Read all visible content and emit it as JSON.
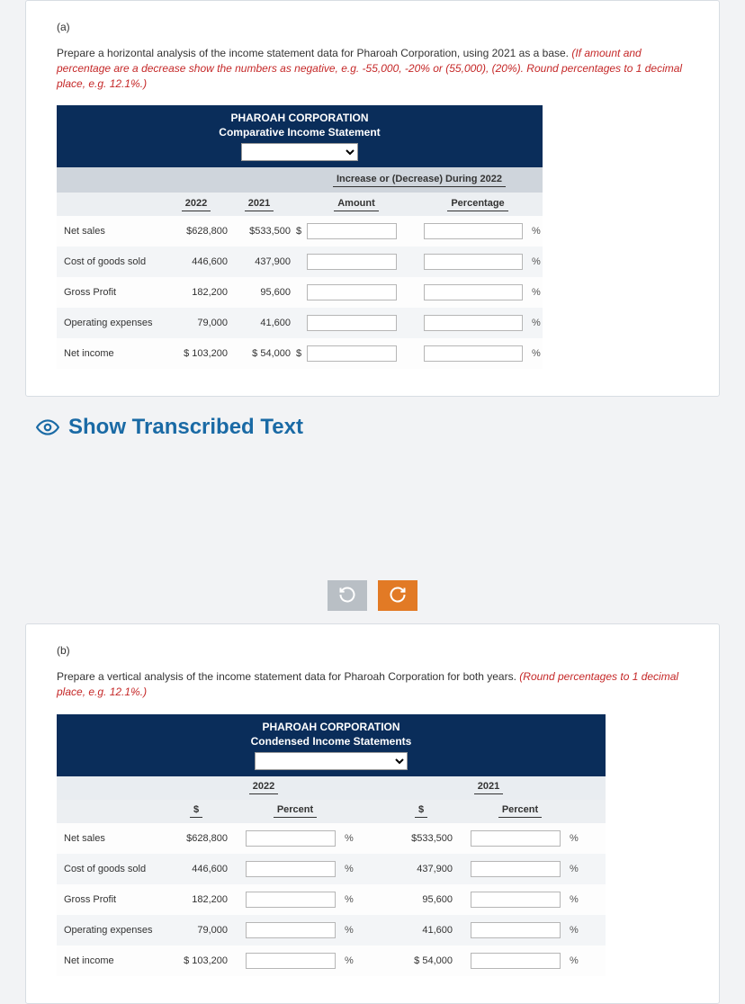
{
  "partA": {
    "label": "(a)",
    "prompt_plain": "Prepare a horizontal analysis of the income statement data for Pharoah Corporation, using 2021 as a base. ",
    "prompt_red": "(If amount and percentage are a decrease show the numbers as negative, e.g. -55,000, -20% or (55,000), (20%). Round percentages to 1 decimal place, e.g. 12.1%.)",
    "title1": "PHAROAH CORPORATION",
    "title2": "Comparative Income Statement",
    "merge_header": "Increase or (Decrease) During 2022",
    "col_2022": "2022",
    "col_2021": "2021",
    "col_amount": "Amount",
    "col_percent": "Percentage",
    "rows": [
      {
        "label": "Net sales",
        "v22": "$628,800",
        "v21": "$533,500",
        "ds": "$"
      },
      {
        "label": "Cost of goods sold",
        "v22": "446,600",
        "v21": "437,900",
        "ds": ""
      },
      {
        "label": "Gross Profit",
        "v22": "182,200",
        "v21": "95,600",
        "ds": ""
      },
      {
        "label": "Operating expenses",
        "v22": "79,000",
        "v21": "41,600",
        "ds": ""
      },
      {
        "label": "Net income",
        "v22": "$ 103,200",
        "v21": "$ 54,000",
        "ds": "$"
      }
    ]
  },
  "showText": "Show Transcribed Text",
  "partB": {
    "label": "(b)",
    "prompt_plain": "Prepare a vertical analysis of the income statement data for Pharoah Corporation for both years. ",
    "prompt_red": "(Round percentages to 1 decimal place, e.g. 12.1%.)",
    "title1": "PHAROAH CORPORATION",
    "title2": "Condensed Income Statements",
    "col_2022": "2022",
    "col_2021": "2021",
    "col_dollar": "$",
    "col_percent": "Percent",
    "rows": [
      {
        "label": "Net sales",
        "v22": "$628,800",
        "v21": "$533,500"
      },
      {
        "label": "Cost of goods sold",
        "v22": "446,600",
        "v21": "437,900"
      },
      {
        "label": "Gross Profit",
        "v22": "182,200",
        "v21": "95,600"
      },
      {
        "label": "Operating expenses",
        "v22": "79,000",
        "v21": "41,600"
      },
      {
        "label": "Net income",
        "v22": "$ 103,200",
        "v21": "$ 54,000"
      }
    ]
  },
  "pct_sign": "%"
}
